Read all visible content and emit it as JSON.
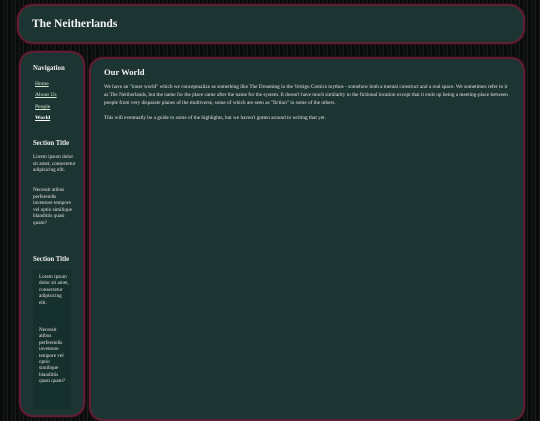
{
  "header": {
    "title": "The Neitherlands"
  },
  "sidebar": {
    "nav_heading": "Navigation",
    "nav_items": [
      {
        "label": "Home"
      },
      {
        "label": "About Us"
      },
      {
        "label": "People"
      },
      {
        "label": "World"
      }
    ],
    "section1": {
      "title": "Section Title",
      "paragraphs": [
        "Lorem ipsum dolor sit amet, consectetur adipisicing elit.",
        "Necessit atibus perferendis inventore tempore vel optio similique blanditiis quasi quam?"
      ]
    },
    "section2": {
      "title": "Section Title",
      "paragraphs": [
        "Lorem ipsum dolor sit amet, consectetur adipisicing elit.",
        "Necessit atibus perferendis inventore tempore vel optio similique blanditiis quasi quam?"
      ]
    }
  },
  "main": {
    "heading": "Our World",
    "paragraphs": [
      "We have an \"inner world\" which we conceptualize as something like The Dreaming in the Vertigo Comics mythos - somehow both a mental construct and a real space. We sometimes refer to it as The Neitherlands, but the name for the place came after the name for the system. It doesn't have much similarity to the fictional location except that it ends up being a meeting-place between people from very disparate planes of the multiverse, some of which are seen as \"fiction\" in some of the others.",
      "This will eventually be a guide to some of the highlights, but we haven't gotten around to writing that yet."
    ]
  }
}
